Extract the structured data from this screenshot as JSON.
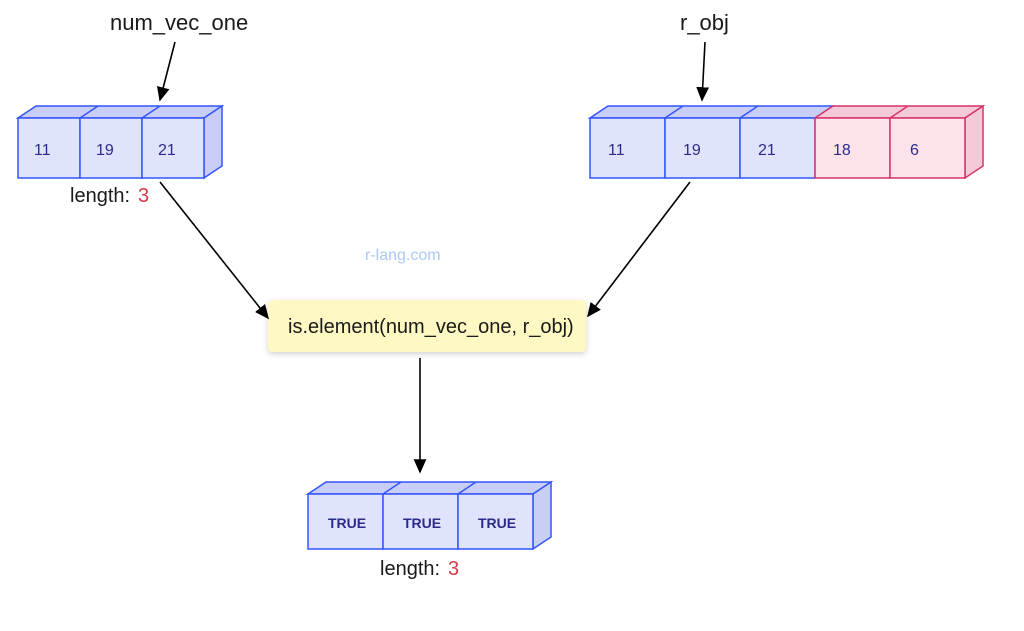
{
  "labels": {
    "vec1_title": "num_vec_one",
    "vec2_title": "r_obj",
    "length_label": "length:",
    "length_value": "3",
    "function_call": "is.element(num_vec_one, r_obj)",
    "watermark": "r-lang.com"
  },
  "vec1": {
    "cells": [
      "11",
      "19",
      "21"
    ]
  },
  "vec2": {
    "cells_blue": [
      "11",
      "19",
      "21"
    ],
    "cells_pink": [
      "18",
      "6"
    ]
  },
  "result": {
    "cells": [
      "TRUE",
      "TRUE",
      "TRUE"
    ]
  },
  "colors": {
    "blue_stroke": "#3355ff",
    "blue_fill": "#dfe3fb",
    "pink_stroke": "#d6336c",
    "pink_fill": "#fde2ea",
    "func_fill": "#fef9c3",
    "accent_red": "#d73a49"
  }
}
